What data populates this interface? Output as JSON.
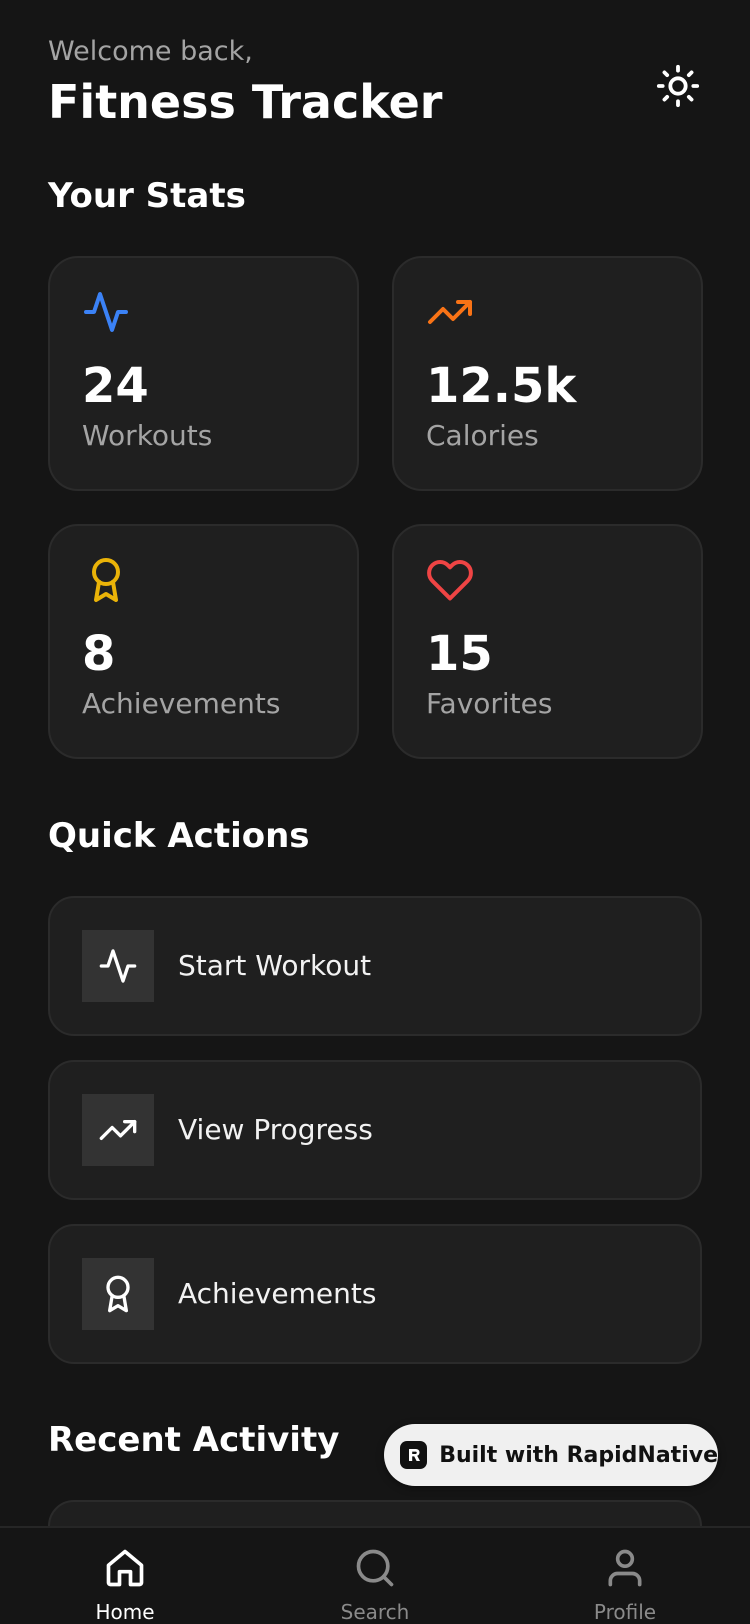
{
  "header": {
    "welcome": "Welcome back,",
    "title": "Fitness Tracker"
  },
  "stats": {
    "title": "Your Stats",
    "items": [
      {
        "value": "24",
        "label": "Workouts",
        "icon": "activity-icon",
        "color": "#3b82f6"
      },
      {
        "value": "12.5k",
        "label": "Calories",
        "icon": "trending-up-icon",
        "color": "#f97316"
      },
      {
        "value": "8",
        "label": "Achievements",
        "icon": "award-icon",
        "color": "#eab308"
      },
      {
        "value": "15",
        "label": "Favorites",
        "icon": "heart-icon",
        "color": "#ef4444"
      }
    ]
  },
  "quick_actions": {
    "title": "Quick Actions",
    "items": [
      {
        "label": "Start Workout",
        "icon": "activity-icon"
      },
      {
        "label": "View Progress",
        "icon": "trending-up-icon"
      },
      {
        "label": "Achievements",
        "icon": "award-icon"
      }
    ]
  },
  "recent_activity": {
    "title": "Recent Activity"
  },
  "badge": {
    "text": "Built with RapidNative"
  },
  "tabs": [
    {
      "label": "Home",
      "icon": "home-icon",
      "active": true
    },
    {
      "label": "Search",
      "icon": "search-icon",
      "active": false
    },
    {
      "label": "Profile",
      "icon": "user-icon",
      "active": false
    }
  ],
  "colors": {
    "background": "#151515",
    "card": "#1f1f1f",
    "muted_text": "#a4a4a4"
  }
}
